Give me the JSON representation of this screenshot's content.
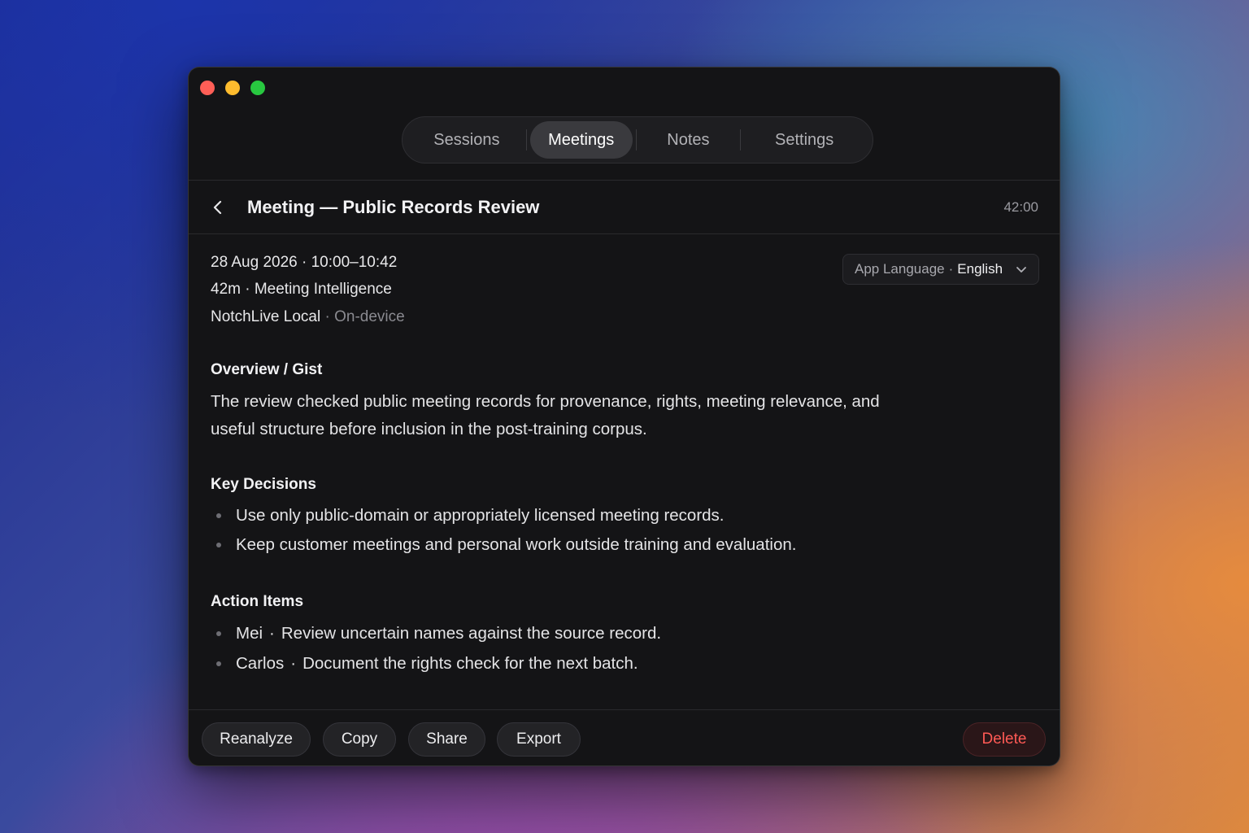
{
  "window": {
    "controls": {
      "close_color": "#ff5f57",
      "minimize_color": "#febc2e",
      "zoom_color": "#28c840"
    }
  },
  "tabs": [
    {
      "label": "Sessions",
      "active": false
    },
    {
      "label": "Meetings",
      "active": true
    },
    {
      "label": "Notes",
      "active": false
    },
    {
      "label": "Settings",
      "active": false
    }
  ],
  "header": {
    "back_icon": "chevron-left-icon",
    "title": "Meeting — Public Records Review",
    "duration": "42:00"
  },
  "meta": {
    "datetime": "28 Aug 2026 · 10:00–10:42",
    "length_type": "42m · Meeting Intelligence",
    "engine": "NotchLive Local",
    "engine_sep": " · ",
    "engine_mode": "On-device"
  },
  "language_select": {
    "label": "App Language",
    "separator": "·",
    "value": "English",
    "icon": "chevron-down-icon"
  },
  "sections": {
    "overview": {
      "title": "Overview / Gist",
      "line1": "The review checked public meeting records for provenance, rights, meeting relevance, and",
      "line2": "useful structure before inclusion in the post-training corpus."
    },
    "decisions": {
      "title": "Key Decisions",
      "items": [
        "Use only public-domain or appropriately licensed meeting records.",
        "Keep customer meetings and personal work outside training and evaluation."
      ]
    },
    "actions": {
      "title": "Action Items",
      "separator": "·",
      "items": [
        {
          "owner": "Mei",
          "task": "Review uncertain names against the source record."
        },
        {
          "owner": "Carlos",
          "task": "Document the rights check for the next batch."
        }
      ]
    }
  },
  "footer": {
    "reanalyze": "Reanalyze",
    "copy": "Copy",
    "share": "Share",
    "export": "Export",
    "delete": "Delete"
  },
  "colors": {
    "window_bg": "#141416",
    "active_tab_bg": "#3a3a3e",
    "danger_text": "#ff5a55"
  }
}
